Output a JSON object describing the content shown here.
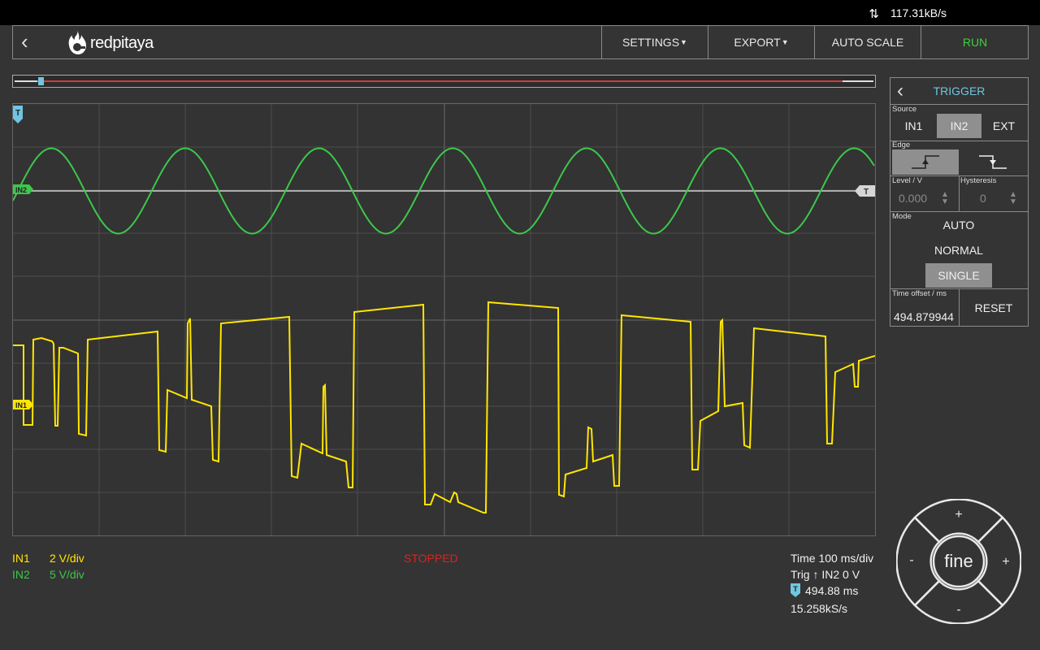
{
  "status_bar": {
    "net_icon": "up-down-arrows-icon",
    "net_rate": "117.31kB/s"
  },
  "header": {
    "back_icon": "chevron-left-icon",
    "logo_text": "redpitaya",
    "settings_label": "SETTINGS",
    "export_label": "EXPORT",
    "autoscale_label": "AUTO SCALE",
    "run_label": "RUN",
    "run_color": "#3cd23c"
  },
  "plot": {
    "trigger_marker": "T",
    "in2_marker": "IN2",
    "in1_marker": "IN1",
    "trigger_level_marker": "T",
    "in1_color": "#ffe600",
    "in2_color": "#3cc84a",
    "trigger_color": "#6fc6e0"
  },
  "channels": {
    "in1": {
      "label": "IN1",
      "scale": "2 V/div"
    },
    "in2": {
      "label": "IN2",
      "scale": "5 V/div"
    }
  },
  "acquisition": {
    "status": "STOPPED",
    "time_div": "Time 100 ms/div",
    "trig": "Trig ↑ IN2 0 V",
    "trigger_offset": "494.88 ms",
    "sample_rate": "15.258kS/s"
  },
  "trigger_panel": {
    "title": "TRIGGER",
    "source_label": "Source",
    "sources": [
      "IN1",
      "IN2",
      "EXT"
    ],
    "selected_source": "IN2",
    "edge_label": "Edge",
    "selected_edge": "rising",
    "level_label": "Level / V",
    "level_value": "0.000",
    "hysteresis_label": "Hysteresis",
    "hysteresis_value": "0",
    "mode_label": "Mode",
    "modes": [
      "AUTO",
      "NORMAL",
      "SINGLE"
    ],
    "selected_mode": "SINGLE",
    "time_offset_label": "Time offset / ms",
    "time_offset_value": "494.879944",
    "reset_label": "RESET"
  },
  "knob": {
    "center_label": "fine",
    "plus": "+",
    "minus": "-"
  }
}
